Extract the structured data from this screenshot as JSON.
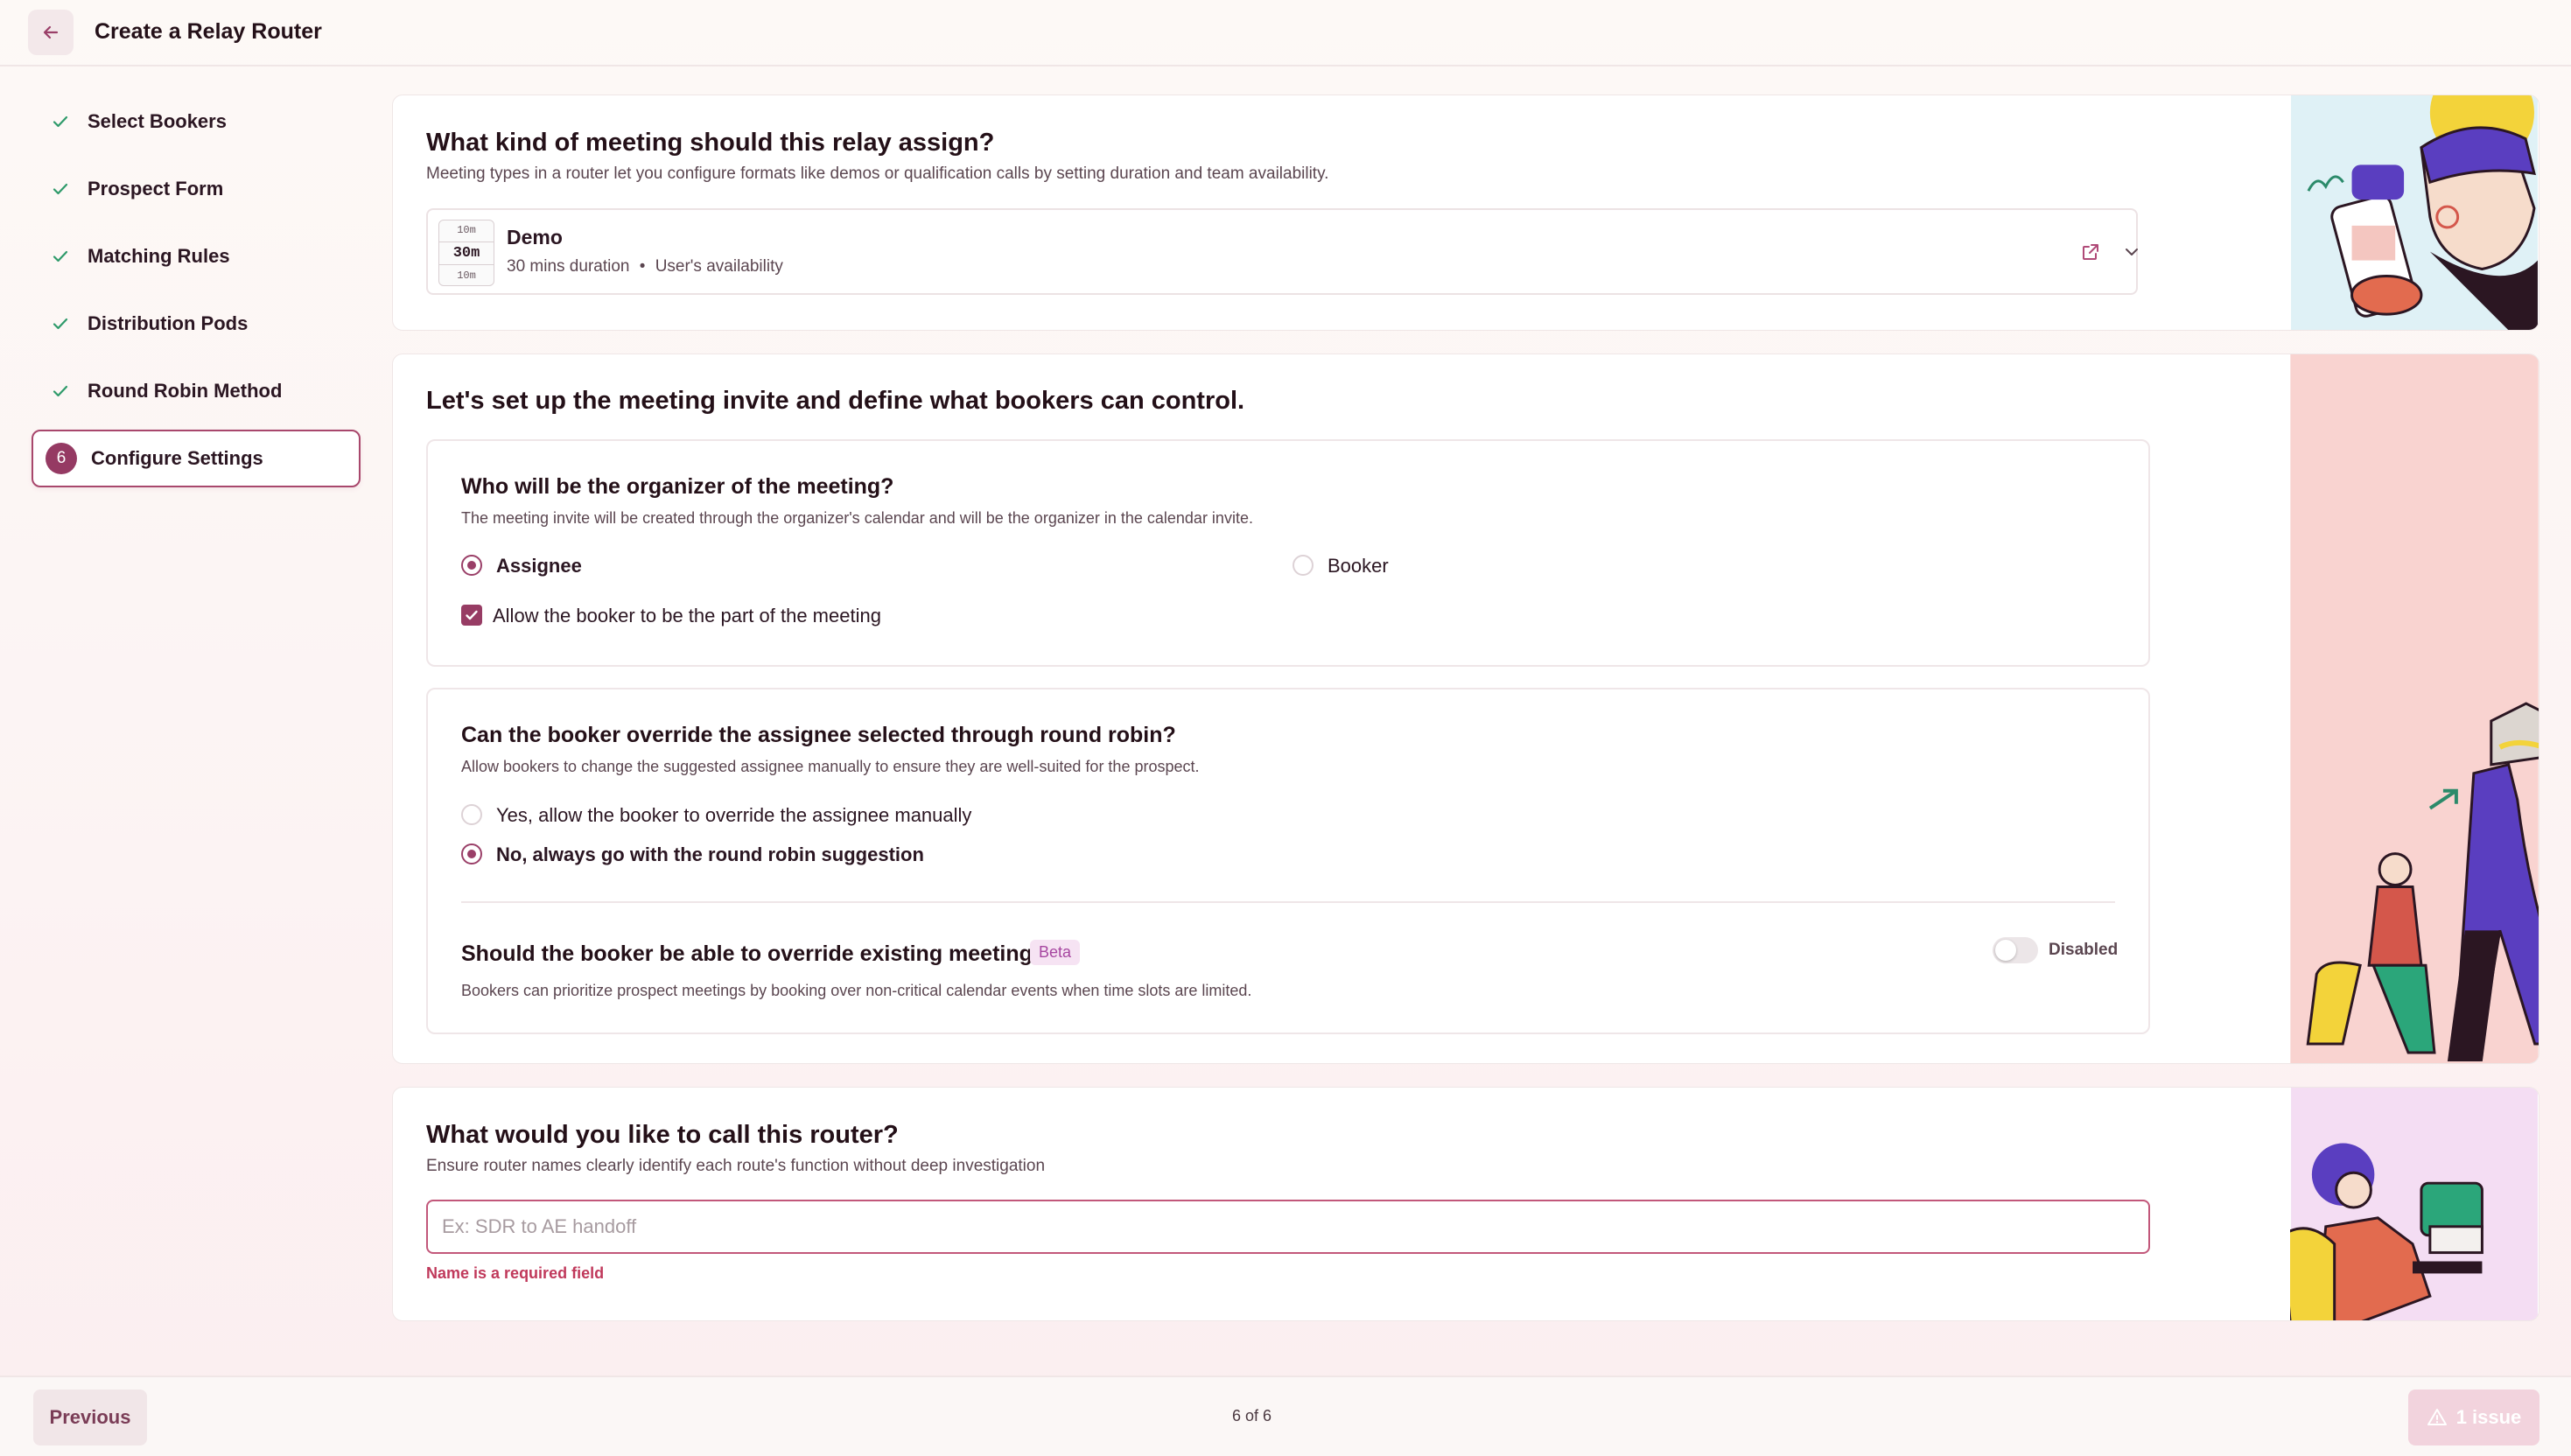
{
  "header": {
    "title": "Create a Relay Router",
    "back_icon": "arrow-left-icon"
  },
  "sidebar": {
    "steps": [
      {
        "label": "Select Bookers",
        "status": "done"
      },
      {
        "label": "Prospect Form",
        "status": "done"
      },
      {
        "label": "Matching Rules",
        "status": "done"
      },
      {
        "label": "Distribution Pods",
        "status": "done"
      },
      {
        "label": "Round Robin Method",
        "status": "done"
      },
      {
        "label": "Configure Settings",
        "status": "active",
        "number": "6"
      }
    ]
  },
  "meeting_card": {
    "title": "What kind of meeting should this relay assign?",
    "subtitle": "Meeting types in a router let you configure formats like demos or qualification calls by setting duration and team availability.",
    "selected": {
      "name": "Demo",
      "buffer_before": "10m",
      "duration_short": "30m",
      "buffer_after": "10m",
      "duration": "30 mins duration",
      "separator": "•",
      "availability": "User's availability"
    }
  },
  "invite_card": {
    "title": "Let's set up the meeting invite and define what bookers can control.",
    "organizer": {
      "question": "Who will be the organizer of the meeting?",
      "description": "The meeting invite will be created through the organizer's calendar and will be the organizer in the calendar invite.",
      "options": [
        "Assignee",
        "Booker"
      ],
      "selected": "Assignee",
      "checkbox_label": "Allow the booker to be the part of the meeting",
      "checkbox_checked": true
    },
    "override": {
      "question": "Can the booker override the assignee selected through round robin?",
      "description": "Allow bookers to change the suggested assignee manually to ensure they are well-suited for the prospect.",
      "options": [
        "Yes, allow the booker to override the assignee manually",
        "No, always go with the round robin suggestion"
      ],
      "selected": "No, always go with the round robin suggestion"
    },
    "existing": {
      "question": "Should the booker be able to override existing meetings?",
      "badge": "Beta",
      "description": "Bookers can prioritize prospect meetings by booking over non-critical calendar events when time slots are limited.",
      "toggle_label": "Disabled",
      "toggle_on": false
    }
  },
  "name_card": {
    "title": "What would you like to call this router?",
    "subtitle": "Ensure router names clearly identify each route's function without deep investigation",
    "placeholder": "Ex: SDR to AE handoff",
    "value": "",
    "error": "Name is a required field"
  },
  "footer": {
    "previous_label": "Previous",
    "page_indicator": "6 of 6",
    "issue_label": "1 issue"
  },
  "colors": {
    "accent": "#953a63",
    "error": "#c0395b",
    "illus_blue": "#dff1f6",
    "illus_pink": "#f9d3d0",
    "illus_lilac": "#f4ddf3"
  }
}
